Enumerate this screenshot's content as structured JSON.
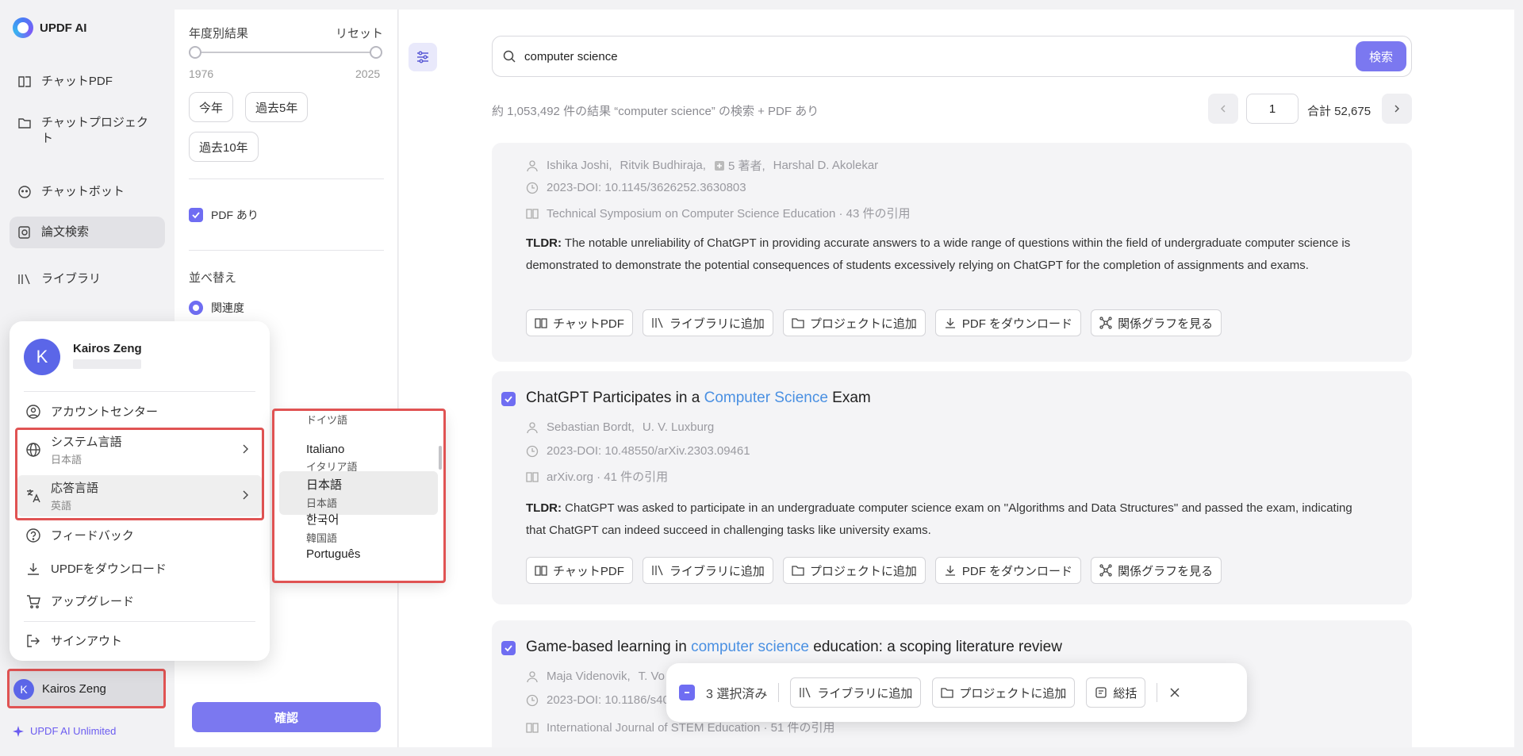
{
  "app": {
    "name": "UPDF AI"
  },
  "sidebar": {
    "items": [
      {
        "label": "チャットPDF"
      },
      {
        "label": "チャットプロジェクト"
      },
      {
        "label": "チャットボット"
      },
      {
        "label": "論文検索"
      },
      {
        "label": "ライブラリ"
      }
    ],
    "user": {
      "initial": "K",
      "name": "Kairos Zeng"
    },
    "plan": "UPDF AI Unlimited"
  },
  "filters": {
    "year_title": "年度別結果",
    "reset": "リセット",
    "year_min": "1976",
    "year_max": "2025",
    "chips": [
      "今年",
      "過去5年",
      "過去10年"
    ],
    "pdf_label": "PDF あり",
    "sort_title": "並べ替え",
    "sort_selected": "関連度",
    "confirm": "確認"
  },
  "search": {
    "query": "computer science",
    "button": "検索"
  },
  "results_summary": "約 1,053,492 件の結果 “computer science” の検索 + PDF あり",
  "pager": {
    "page": "1",
    "total": "合計 52,675"
  },
  "results": [
    {
      "authors": [
        "Ishika Joshi,",
        "Ritvik Budhiraja,",
        "5 著者,",
        "Harshal D. Akolekar"
      ],
      "doi": "2023-DOI: 10.1145/3626252.3630803",
      "venue": "Technical Symposium on Computer Science Education · 43 件の引用",
      "tldr_label": "TLDR:",
      "tldr": "The notable unreliability of ChatGPT in providing accurate answers to a wide range of questions within the field of undergraduate computer science is demonstrated to demonstrate the potential consequences of students excessively relying on ChatGPT for the completion of assignments and exams."
    },
    {
      "title_pre": "ChatGPT Participates in a ",
      "title_hl": "Computer Science",
      "title_post": " Exam",
      "authors": [
        "Sebastian Bordt,",
        "U. V. Luxburg"
      ],
      "doi": "2023-DOI: 10.48550/arXiv.2303.09461",
      "venue": "arXiv.org · 41 件の引用",
      "tldr_label": "TLDR:",
      "tldr": "ChatGPT was asked to participate in an undergraduate computer science exam on ''Algorithms and Data Structures'' and passed the exam, indicating that ChatGPT can indeed succeed in challenging tasks like university exams."
    },
    {
      "title_pre": "Game-based learning in ",
      "title_hl": "computer science",
      "title_post": " education: a scoping literature review",
      "authors": [
        "Maja Videnovik,",
        "T. Vo"
      ],
      "doi": "2023-DOI: 10.1186/s40",
      "venue": "International Journal of STEM Education · 51 件の引用"
    }
  ],
  "actions": [
    "チャットPDF",
    "ライブラリに追加",
    "プロジェクトに追加",
    "PDF をダウンロード",
    "関係グラフを見る"
  ],
  "selection_bar": {
    "count": "3 選択済み",
    "add_library": "ライブラリに追加",
    "add_project": "プロジェクトに追加",
    "summary": "総括"
  },
  "account_menu": {
    "name": "Kairos Zeng",
    "initial": "K",
    "account_center": "アカウントセンター",
    "system_lang": {
      "label": "システム言語",
      "value": "日本語"
    },
    "response_lang": {
      "label": "応答言語",
      "value": "英語"
    },
    "feedback": "フィードバック",
    "download": "UPDFをダウンロード",
    "upgrade": "アップグレード",
    "signout": "サインアウト"
  },
  "language_menu": [
    {
      "name": "",
      "native": "ドイツ語"
    },
    {
      "name": "Italiano",
      "native": "イタリア語"
    },
    {
      "name": "日本語",
      "native": "日本語"
    },
    {
      "name": "한국어",
      "native": "韓国語"
    },
    {
      "name": "Português",
      "native": ""
    }
  ],
  "colors": {
    "accent": "#7b78f0",
    "highlight_text": "#4a90e2",
    "annotation_red": "#e05353"
  }
}
